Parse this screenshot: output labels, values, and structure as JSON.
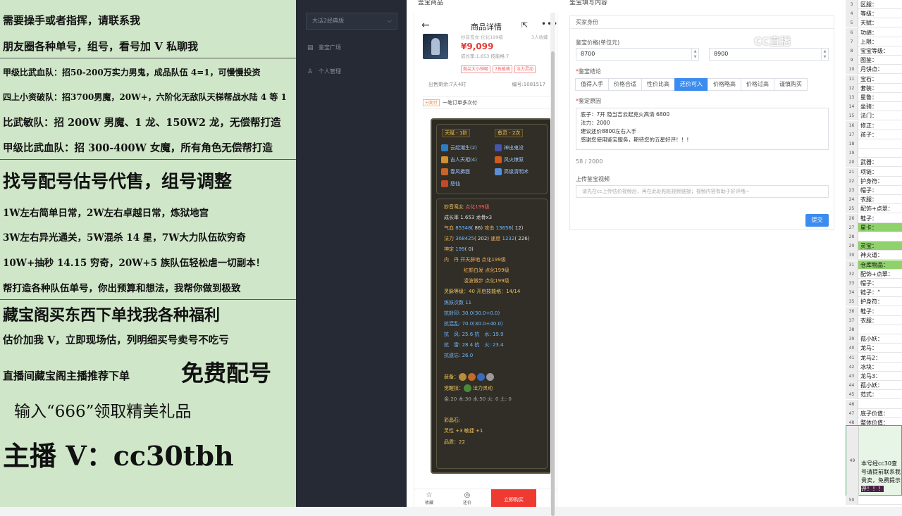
{
  "promo": {
    "lines": [
      "需要操手或者指挥，请联系我",
      "朋友圈各种单号，组号，看号加 V 私聊我",
      "甲级比武血队：招50-200万实力男鬼，成品队伍 4=1，可慢慢投资",
      "四上小资破队：招3700男魔，20W+，六阶化无敌队天梯帮战水陆 4 等 1",
      "比武敏队：招 200W 男魔、1 龙、150W2 龙，无偿帮打造",
      "甲级比武血队：招 300-400W 女魔，所有角色无偿帮打造",
      "找号配号估号代售，组号调整",
      "1W左右简单日常，2W左右卓越日常，炼狱地宫",
      "3W左右异光通关，5W混杀 14 星，7W大力队伍砍穷奇",
      "10W+抽秒 14.15 穷奇，20W+5 族队伍轻松虐一切副本！",
      "帮打造各种队伍单号，你出预算和想法，我帮你做到极致",
      "藏宝阁买东西下单找我各种福利",
      "估价加我 V，立即现场估，列明细买号卖号不吃亏",
      "直播间藏宝阁主播推荐下单",
      "免费配号",
      "输入“666”领取精美礼品",
      "主播 V：cc30tbh"
    ]
  },
  "nav": {
    "server_select": "大话2经典版",
    "items": [
      "鉴宝广场",
      "个人管理"
    ]
  },
  "content": {
    "left_header": "鉴宝商品",
    "right_header": "鉴宝填写内容"
  },
  "phone": {
    "title": "商品详情",
    "product_name": "妙音鸾女  化化199级",
    "product_right": "3人收藏",
    "price": "¥9,099",
    "growth": "成长率:1.653 技能格:7",
    "tags": [
      "指尖大小钟吸",
      "7技能格",
      "法力灵动"
    ],
    "sale_left": "出售剩余:7天4时",
    "sale_right": "编号:1081517",
    "ship_tag": "分期付",
    "ship_text": "一笔订单多次付",
    "bottom": {
      "fav": "收藏",
      "chat": "还价",
      "buy": "立即购买"
    }
  },
  "card": {
    "top_tags": [
      "天赋 - 1阶",
      "愈灵 - 2次"
    ],
    "skills": [
      "云起潮生(2)",
      "神出鬼没",
      "吉人天相(4)",
      "风火燎原",
      "春风拂面",
      "高级清明术",
      "怒仙"
    ],
    "name": "妙音鸾女",
    "name_tag": "点化199级",
    "growth": "成长率 1.653 龙骨x3",
    "hp_label": "气血",
    "hp": "85348",
    "hp_b": "( 86)",
    "atk_label": "攻击",
    "atk": "13656",
    "atk_b": "( 12)",
    "mp_label": "法力",
    "mp": "368425",
    "mp_b": "( 202)",
    "spd_label": "速度",
    "spd": "1232",
    "spd_b": "( 226)",
    "zd_label": "神定",
    "zd": "199",
    "zd_b": "( 0)",
    "dan_label": "内　丹",
    "dan": [
      "开天辟地 点化199级",
      "红颜白发 点化199级",
      "凌波微步 点化199级"
    ],
    "ling": "灵脉等级：40 开启技能格：14/14",
    "yao": "炼妖次数 11",
    "res1": "抗封印: 30.0(30.0+0.0)",
    "res2": "抗混乱: 70.0(30.0+40.0)",
    "res3": "抗　风: 25.6 抗　水: 19.9",
    "res4": "抗　雷: 28.4 抗　火: 23.4",
    "res5": "抗遗忘: 26.0",
    "equip_label": "装备：",
    "awake_label": "觉醒技：",
    "awake": "法力灵动",
    "elements": "金:20 木:30 水:50 火: 0 土: 0",
    "stone_label": "彩晶石:",
    "stone": "灵性 +3 敏捷 +1",
    "quality": "品质：22"
  },
  "form": {
    "section": "买家身份",
    "price_label": "鉴宝价格(单位元)",
    "price_min": "8700",
    "price_max": "8900",
    "verdict_label": "鉴宝结论",
    "verdicts": [
      "值得入手",
      "价格合适",
      "性价比高",
      "还价可入",
      "价格略高",
      "价格过高",
      "谨慎购买"
    ],
    "verdict_active": "还价可入",
    "reason_label": "鉴定原因",
    "reason": [
      "底子：7开 隐当吉云起克火高清  6800",
      "法力：2000",
      "建议还价8800左右入手",
      "感谢您使用鉴宝服务，期待您的五星好评！！！"
    ],
    "count": "58 / 2000",
    "upload_label": "上传鉴宝视频",
    "upload_placeholder": "请先在cc上传估价视频后，再在此处粘贴视频链接；视频内容有助于好评哦~",
    "submit": "提交"
  },
  "watermark": "CC直播",
  "sheet": {
    "rows": [
      {
        "n": "3",
        "v": "区服："
      },
      {
        "n": "4",
        "v": "等级："
      },
      {
        "n": "5",
        "v": "天赋："
      },
      {
        "n": "6",
        "v": "功绩："
      },
      {
        "n": "7",
        "v": "上限："
      },
      {
        "n": "8",
        "v": "宝宝等级："
      },
      {
        "n": "9",
        "v": "图鉴："
      },
      {
        "n": "10",
        "v": "月饼点："
      },
      {
        "n": "11",
        "v": "宝石："
      },
      {
        "n": "12",
        "v": "套装："
      },
      {
        "n": "13",
        "v": "星鲁："
      },
      {
        "n": "14",
        "v": "坐骑："
      },
      {
        "n": "15",
        "v": "法门："
      },
      {
        "n": "16",
        "v": "修正："
      },
      {
        "n": "17",
        "v": "孩子："
      },
      {
        "n": "18",
        "v": ""
      },
      {
        "n": "19",
        "v": ""
      },
      {
        "n": "20",
        "v": "武器："
      },
      {
        "n": "21",
        "v": "项链："
      },
      {
        "n": "22",
        "v": "护身符："
      },
      {
        "n": "23",
        "v": "帽子："
      },
      {
        "n": "24",
        "v": "衣服："
      },
      {
        "n": "25",
        "v": "配饰+点翠："
      },
      {
        "n": "26",
        "v": "鞋子："
      },
      {
        "n": "27",
        "v": "星卡：",
        "g": true
      },
      {
        "n": "28",
        "v": ""
      },
      {
        "n": "29",
        "v": "灵宝：",
        "g": true
      },
      {
        "n": "30",
        "v": "神火道："
      },
      {
        "n": "31",
        "v": "仓库物品：",
        "g": true
      },
      {
        "n": "32",
        "v": "配饰+点翠："
      },
      {
        "n": "33",
        "v": "帽子："
      },
      {
        "n": "34",
        "v": "链子：“"
      },
      {
        "n": "35",
        "v": "护身符："
      },
      {
        "n": "36",
        "v": "鞋子："
      },
      {
        "n": "37",
        "v": "衣服："
      },
      {
        "n": "38",
        "v": ""
      },
      {
        "n": "39",
        "v": "孤小妖："
      },
      {
        "n": "40",
        "v": "龙马："
      },
      {
        "n": "41",
        "v": "龙马2："
      },
      {
        "n": "42",
        "v": "冰块："
      },
      {
        "n": "43",
        "v": "龙马3："
      },
      {
        "n": "44",
        "v": "孤小妖："
      },
      {
        "n": "45",
        "v": "范式："
      },
      {
        "n": "46",
        "v": ""
      },
      {
        "n": "47",
        "v": "底子价值："
      },
      {
        "n": "48",
        "v": "整体价值："
      }
    ],
    "big_row_num": "49",
    "big_text": [
      "本号经cc30查",
      "号请提前联系我",
      "贵卖，免费提示",
      "评！！！"
    ],
    "last_row": "50"
  }
}
